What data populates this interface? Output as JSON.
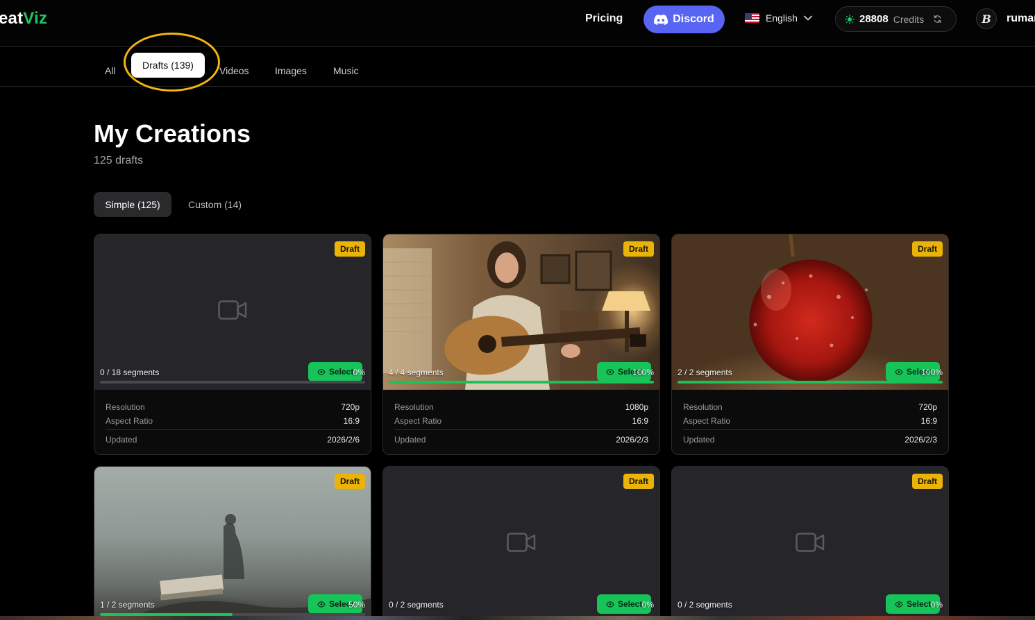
{
  "header": {
    "logo_part1": "eat",
    "logo_part2": "Viz",
    "pricing": "Pricing",
    "discord": "Discord",
    "language": "English",
    "credits_value": "28808",
    "credits_label": "Credits",
    "username": "rumar"
  },
  "tabs": {
    "all": "All",
    "drafts": "Drafts (139)",
    "videos": "Videos",
    "images": "Images",
    "music": "Music",
    "active": "drafts"
  },
  "main": {
    "title": "My Creations",
    "subtitle": "125 drafts",
    "subtabs": {
      "simple": "Simple (125)",
      "custom": "Custom (14)",
      "active": "simple"
    }
  },
  "labels": {
    "badge": "Draft",
    "select": "Select",
    "resolution": "Resolution",
    "aspect_ratio": "Aspect Ratio",
    "updated": "Updated"
  },
  "cards": [
    {
      "segments": "0 / 18 segments",
      "percent": "0%",
      "progress": 0,
      "resolution": "720p",
      "aspect": "16:9",
      "updated": "2026/2/6",
      "thumbnail": "placeholder-video-icon"
    },
    {
      "segments": "4 / 4 segments",
      "percent": "100%",
      "progress": 1,
      "resolution": "1080p",
      "aspect": "16:9",
      "updated": "2026/2/3",
      "thumbnail": "woman-playing-guitar-photo"
    },
    {
      "segments": "2 / 2 segments",
      "percent": "100%",
      "progress": 1,
      "resolution": "720p",
      "aspect": "16:9",
      "updated": "2026/2/3",
      "thumbnail": "red-apple-photo"
    },
    {
      "segments": "1 / 2 segments",
      "percent": "50%",
      "progress": 0.5,
      "thumbnail": "foggy-figure-photo"
    },
    {
      "segments": "0 / 2 segments",
      "percent": "0%",
      "progress": 0,
      "thumbnail": "placeholder-video-icon"
    },
    {
      "segments": "0 / 2 segments",
      "percent": "0%",
      "progress": 0,
      "thumbnail": "placeholder-video-icon"
    }
  ],
  "colors": {
    "accent_green": "#16c45a",
    "draft_badge": "#eab308",
    "discord": "#5865f2",
    "highlight_ring": "#f4b60f"
  }
}
